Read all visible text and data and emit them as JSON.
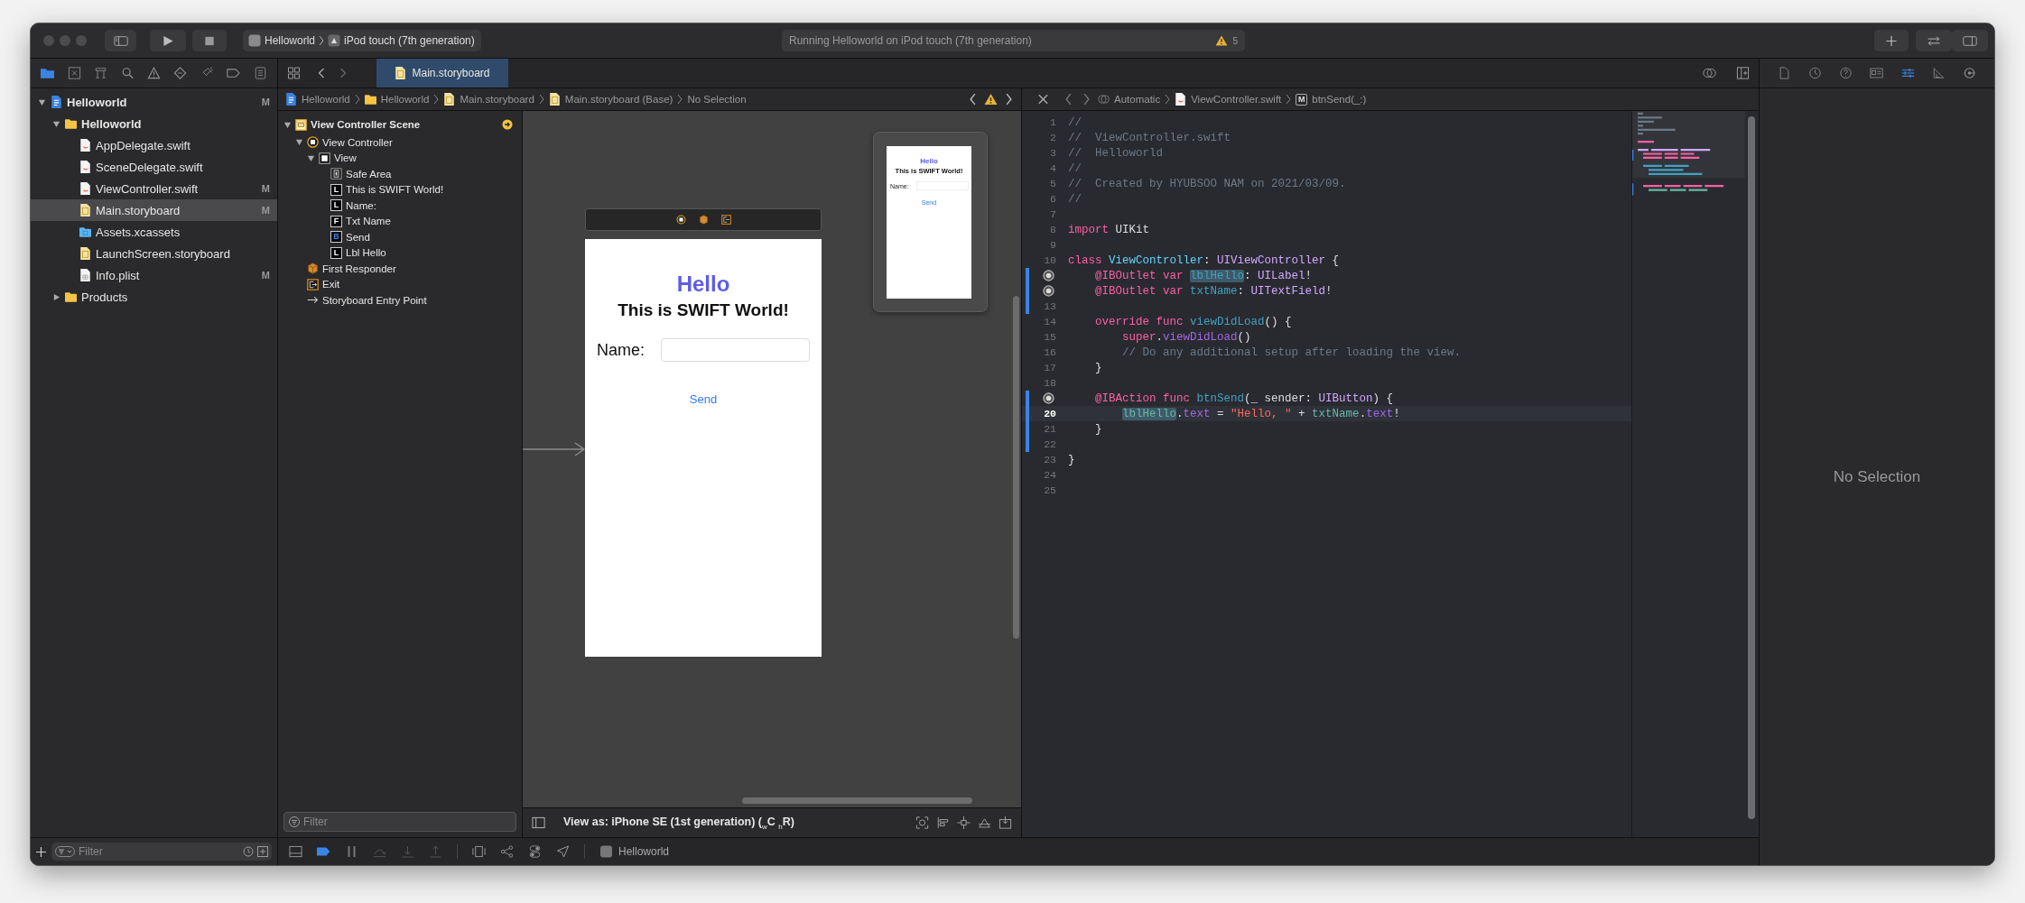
{
  "toolbar": {
    "scheme": "Helloworld",
    "destination": "iPod touch (7th generation)",
    "status": "Running Helloworld on iPod touch (7th generation)",
    "warning_count": "5"
  },
  "navigator": {
    "tabs": [
      {
        "kind": "project",
        "selected": true
      },
      {
        "kind": "source-control",
        "selected": false
      },
      {
        "kind": "symbols",
        "selected": false
      },
      {
        "kind": "find",
        "selected": false
      },
      {
        "kind": "issues",
        "selected": false
      },
      {
        "kind": "tests",
        "selected": false
      },
      {
        "kind": "debug",
        "selected": false
      },
      {
        "kind": "breakpoints",
        "selected": false
      },
      {
        "kind": "reports",
        "selected": false
      }
    ],
    "tree": [
      {
        "name": "Helloworld",
        "kind": "project",
        "badge": "M",
        "expanded": true,
        "selected": false,
        "children": [
          {
            "name": "Helloworld",
            "kind": "folder",
            "expanded": true,
            "selected": false,
            "children": [
              {
                "name": "AppDelegate.swift",
                "kind": "swift",
                "selected": false
              },
              {
                "name": "SceneDelegate.swift",
                "kind": "swift",
                "selected": false
              },
              {
                "name": "ViewController.swift",
                "kind": "swift",
                "badge": "M",
                "selected": false
              },
              {
                "name": "Main.storyboard",
                "kind": "storyboard",
                "badge": "M",
                "selected": true
              },
              {
                "name": "Assets.xcassets",
                "kind": "assets",
                "selected": false
              },
              {
                "name": "LaunchScreen.storyboard",
                "kind": "storyboard",
                "selected": false
              },
              {
                "name": "Info.plist",
                "kind": "plist",
                "badge": "M",
                "selected": false
              }
            ]
          },
          {
            "name": "Products",
            "kind": "folder",
            "expanded": false,
            "selected": false
          }
        ]
      }
    ],
    "filter_placeholder": "Filter"
  },
  "editor_tabs": [
    {
      "label": "Main.storyboard",
      "selected": true
    }
  ],
  "storyboard": {
    "breadcrumbs": [
      {
        "label": "Helloworld",
        "kind": "project"
      },
      {
        "label": "Helloworld",
        "kind": "folder"
      },
      {
        "label": "Main.storyboard",
        "kind": "storyboard"
      },
      {
        "label": "Main.storyboard (Base)",
        "kind": "storyboard"
      },
      {
        "label": "No Selection",
        "kind": "none"
      }
    ],
    "outline": [
      {
        "name": "View Controller Scene",
        "kind": "scene",
        "expanded": true,
        "children": [
          {
            "name": "View Controller",
            "kind": "controller",
            "expanded": true,
            "children": [
              {
                "name": "View",
                "kind": "view",
                "expanded": true,
                "children": [
                  {
                    "name": "Safe Area",
                    "kind": "safe-area"
                  },
                  {
                    "name": "This is SWIFT World!",
                    "kind": "label",
                    "glyph": "L"
                  },
                  {
                    "name": "Name:",
                    "kind": "label",
                    "glyph": "L"
                  },
                  {
                    "name": "Txt Name",
                    "kind": "field",
                    "glyph": "F"
                  },
                  {
                    "name": "Send",
                    "kind": "button",
                    "glyph": "B"
                  },
                  {
                    "name": "Lbl Hello",
                    "kind": "label",
                    "glyph": "L"
                  }
                ]
              }
            ]
          },
          {
            "name": "First Responder",
            "kind": "responder"
          },
          {
            "name": "Exit",
            "kind": "exit"
          },
          {
            "name": "Storyboard Entry Point",
            "kind": "entry"
          }
        ]
      }
    ],
    "outline_filter_placeholder": "Filter",
    "scene": {
      "title": "Hello",
      "subtitle": "This is SWIFT World!",
      "name_label": "Name:",
      "button": "Send"
    },
    "preview": {
      "title": "Hello",
      "subtitle": "This is SWIFT World!",
      "name_label": "Name:",
      "button": "Send"
    },
    "view_as": "View as: iPhone SE (1st generation) ($_{w}$C $_{h}$R)"
  },
  "code_editor": {
    "breadcrumbs": [
      {
        "label": "Automatic",
        "kind": "related"
      },
      {
        "label": "ViewController.swift",
        "kind": "swift"
      },
      {
        "label": "btnSend(_:)",
        "kind": "method",
        "glyph": "M"
      }
    ],
    "lines": [
      {
        "number": "1",
        "current": false,
        "changed": false,
        "connected": false,
        "tokens": [
          {
            "text": "//",
            "kind": "comment"
          }
        ]
      },
      {
        "number": "2",
        "current": false,
        "changed": false,
        "connected": false,
        "tokens": [
          {
            "text": "//  ViewController.swift",
            "kind": "comment"
          }
        ]
      },
      {
        "number": "3",
        "current": false,
        "changed": false,
        "connected": false,
        "tokens": [
          {
            "text": "//  Helloworld",
            "kind": "comment"
          }
        ]
      },
      {
        "number": "4",
        "current": false,
        "changed": false,
        "connected": false,
        "tokens": [
          {
            "text": "//",
            "kind": "comment"
          }
        ]
      },
      {
        "number": "5",
        "current": false,
        "changed": false,
        "connected": false,
        "tokens": [
          {
            "text": "//  Created by HYUBSOO NAM on 2021/03/09.",
            "kind": "comment"
          }
        ]
      },
      {
        "number": "6",
        "current": false,
        "changed": false,
        "connected": false,
        "tokens": [
          {
            "text": "//",
            "kind": "comment"
          }
        ]
      },
      {
        "number": "7",
        "current": false,
        "changed": false,
        "connected": false
      },
      {
        "number": "8",
        "current": false,
        "changed": false,
        "connected": false,
        "tokens": [
          {
            "text": "import",
            "kind": "keyword"
          },
          {
            "text": " UIKit",
            "kind": "plain"
          }
        ]
      },
      {
        "number": "9",
        "current": false,
        "changed": false,
        "connected": false
      },
      {
        "number": "10",
        "current": false,
        "changed": false,
        "connected": false,
        "tokens": [
          {
            "text": "class ",
            "kind": "keyword"
          },
          {
            "text": "ViewController",
            "kind": "type-declaration"
          },
          {
            "text": ": ",
            "kind": "plain"
          },
          {
            "text": "UIViewController",
            "kind": "system-type"
          },
          {
            "text": " {",
            "kind": "plain"
          }
        ]
      },
      {
        "current": false,
        "changed": true,
        "connected": true,
        "tokens": [
          {
            "text": "    @IBOutlet var ",
            "kind": "keyword"
          },
          {
            "text": "lblHello",
            "kind": "declaration-highlighted"
          },
          {
            "text": ": ",
            "kind": "plain"
          },
          {
            "text": "UILabel",
            "kind": "system-type"
          },
          {
            "text": "!",
            "kind": "plain"
          }
        ]
      },
      {
        "current": false,
        "changed": true,
        "connected": true,
        "tokens": [
          {
            "text": "    @IBOutlet var ",
            "kind": "keyword"
          },
          {
            "text": "txtName",
            "kind": "declaration"
          },
          {
            "text": ": ",
            "kind": "plain"
          },
          {
            "text": "UITextField",
            "kind": "system-type"
          },
          {
            "text": "!",
            "kind": "plain"
          }
        ]
      },
      {
        "number": "13",
        "current": false,
        "changed": true,
        "connected": false
      },
      {
        "number": "14",
        "current": false,
        "changed": false,
        "connected": false,
        "tokens": [
          {
            "text": "    override func ",
            "kind": "keyword"
          },
          {
            "text": "viewDidLoad",
            "kind": "declaration"
          },
          {
            "text": "() {",
            "kind": "plain"
          }
        ]
      },
      {
        "number": "15",
        "current": false,
        "changed": false,
        "connected": false,
        "tokens": [
          {
            "text": "        super",
            "kind": "keyword"
          },
          {
            "text": ".",
            "kind": "plain"
          },
          {
            "text": "viewDidLoad",
            "kind": "system-member"
          },
          {
            "text": "()",
            "kind": "plain"
          }
        ]
      },
      {
        "number": "16",
        "current": false,
        "changed": false,
        "connected": false,
        "tokens": [
          {
            "text": "        // Do any additional setup after loading the view.",
            "kind": "comment"
          }
        ]
      },
      {
        "number": "17",
        "current": false,
        "changed": false,
        "connected": false,
        "tokens": [
          {
            "text": "    }",
            "kind": "plain"
          }
        ]
      },
      {
        "number": "18",
        "current": false,
        "changed": false,
        "connected": false
      },
      {
        "current": false,
        "changed": true,
        "connected": true,
        "tokens": [
          {
            "text": "    @IBAction func ",
            "kind": "keyword"
          },
          {
            "text": "btnSend",
            "kind": "declaration"
          },
          {
            "text": "(_ sender: ",
            "kind": "plain"
          },
          {
            "text": "UIButton",
            "kind": "system-type"
          },
          {
            "text": ") {",
            "kind": "plain"
          }
        ]
      },
      {
        "number": "20",
        "current": true,
        "changed": true,
        "connected": false,
        "tokens": [
          {
            "text": "        lblHello",
            "kind": "reference-highlighted"
          },
          {
            "text": ".",
            "kind": "plain"
          },
          {
            "text": "text",
            "kind": "system-member"
          },
          {
            "text": " = ",
            "kind": "plain"
          },
          {
            "text": "\"Hello, \"",
            "kind": "string"
          },
          {
            "text": " + ",
            "kind": "plain"
          },
          {
            "text": "txtName",
            "kind": "reference"
          },
          {
            "text": ".",
            "kind": "plain"
          },
          {
            "text": "text",
            "kind": "system-member"
          },
          {
            "text": "!",
            "kind": "plain"
          }
        ]
      },
      {
        "number": "21",
        "current": false,
        "changed": true,
        "connected": false,
        "tokens": [
          {
            "text": "    }",
            "kind": "plain"
          }
        ]
      },
      {
        "number": "22",
        "current": false,
        "changed": true,
        "connected": false
      },
      {
        "number": "23",
        "current": false,
        "changed": false,
        "connected": false,
        "tokens": [
          {
            "text": "}",
            "kind": "plain"
          }
        ]
      },
      {
        "number": "24",
        "current": false,
        "changed": false,
        "connected": false
      },
      {
        "number": "25",
        "current": false,
        "changed": false,
        "connected": false
      }
    ]
  },
  "inspector": {
    "tabs": [
      {
        "kind": "file",
        "selected": false
      },
      {
        "kind": "history",
        "selected": false
      },
      {
        "kind": "help",
        "selected": false
      },
      {
        "kind": "identity",
        "selected": false
      },
      {
        "kind": "attributes",
        "selected": true
      },
      {
        "kind": "size",
        "selected": false
      },
      {
        "kind": "connections",
        "selected": false
      }
    ],
    "message": "No Selection"
  },
  "debug_bar": {
    "target": "Helloworld"
  }
}
